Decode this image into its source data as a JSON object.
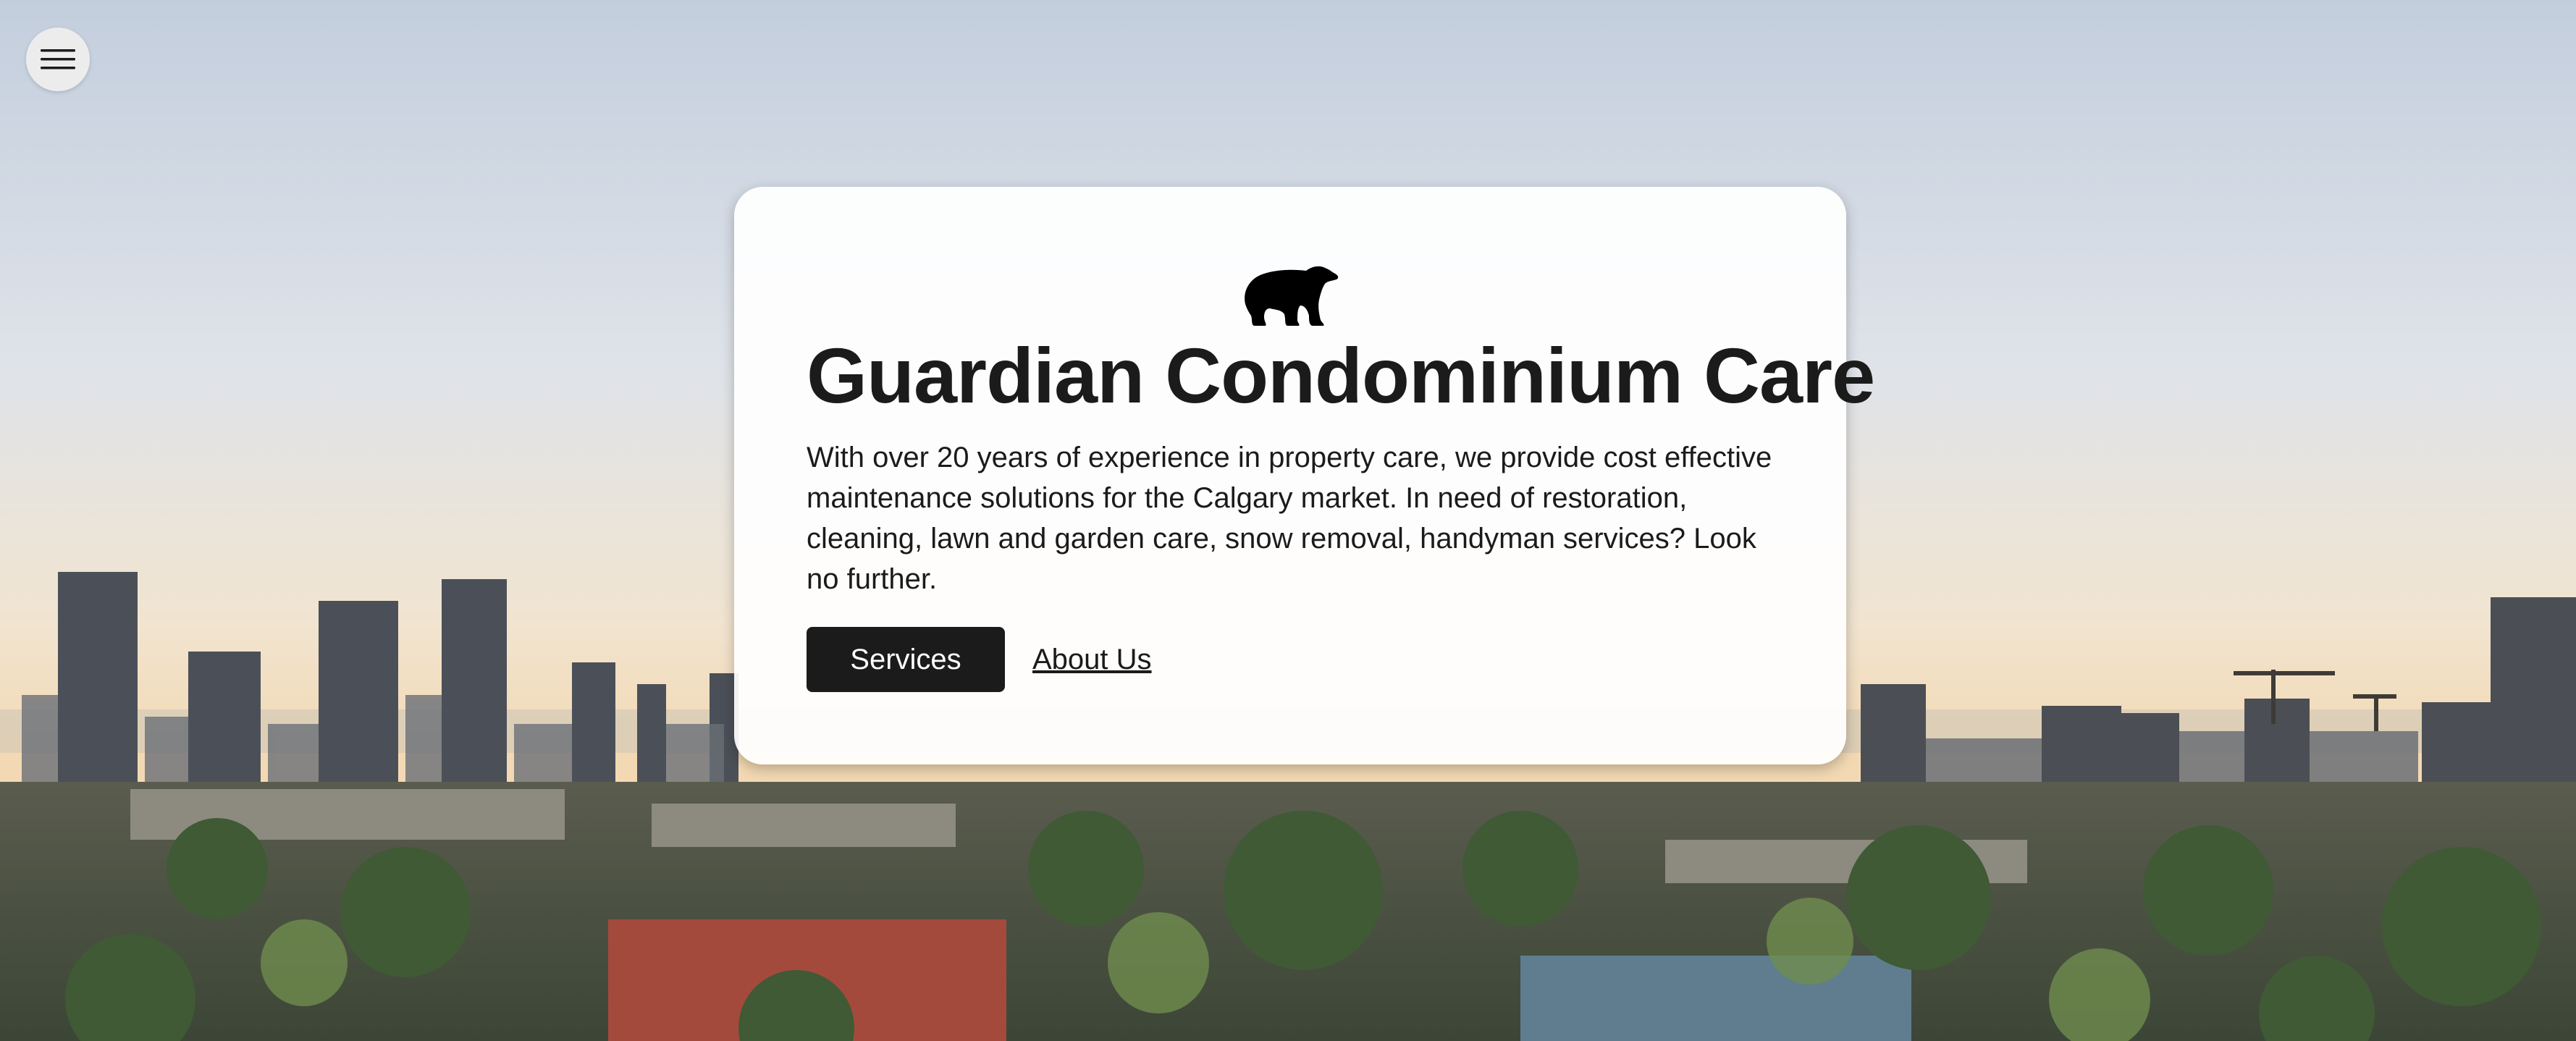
{
  "nav": {
    "menu_icon": "hamburger-menu-icon"
  },
  "hero": {
    "logo_icon": "polar-bear-icon",
    "title": "Guardian Condominium Care",
    "description": "With over 20 years of experience in property care, we provide cost effective maintenance solutions for the Calgary market. In need of restoration, cleaning, lawn and garden care, snow removal, handyman services? Look no further.",
    "primary_button": "Services",
    "secondary_link": "About Us"
  },
  "background": {
    "subject": "city-skyline-photo"
  },
  "colors": {
    "text": "#1b1b1b",
    "button_bg": "#1b1b1b",
    "button_text": "#ffffff",
    "card_bg": "#ffffff"
  }
}
